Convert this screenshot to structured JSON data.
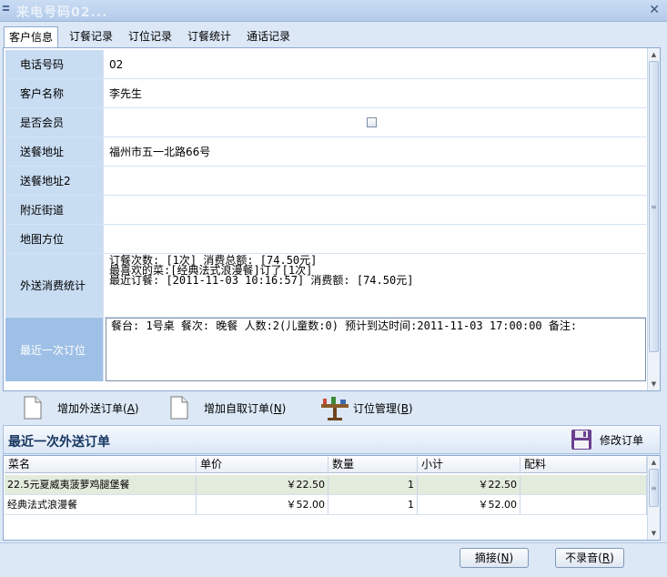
{
  "window": {
    "title": "来电号码02..."
  },
  "tabs": [
    {
      "label": "客户信息"
    },
    {
      "label": "订餐记录"
    },
    {
      "label": "订位记录"
    },
    {
      "label": "订餐统计"
    },
    {
      "label": "通话记录"
    }
  ],
  "customer": {
    "rows": [
      {
        "label": "电话号码",
        "value": "02"
      },
      {
        "label": "客户名称",
        "value": "李先生"
      },
      {
        "label": "是否会员",
        "value": "",
        "checked": false
      },
      {
        "label": "送餐地址",
        "value": "福州市五一北路66号"
      },
      {
        "label": "送餐地址2",
        "value": ""
      },
      {
        "label": "附近街道",
        "value": ""
      },
      {
        "label": "地图方位",
        "value": ""
      },
      {
        "label": "外送消费统计",
        "lines": [
          "订餐次数: [1次]  消费总额: [74.50元]",
          "最喜欢的菜:[经典法式浪漫餐]订了[1次]",
          "最近订餐: [2011-11-03 10:16:57] 消费额: [74.50元]"
        ]
      },
      {
        "label": "最近一次订位",
        "value": "餐台: 1号桌  餐次: 晚餐 人数:2(儿童数:0) 预计到达时间:2011-11-03 17:00:00 备注:"
      }
    ]
  },
  "actions": {
    "add_delivery": "增加外送订单(",
    "add_delivery_key": "A",
    "add_pickup": "增加自取订单(",
    "add_pickup_key": "N",
    "reservation": "订位管理(",
    "reservation_key": "B",
    "close_paren": ")"
  },
  "recent_order": {
    "title": "最近一次外送订单",
    "edit_label": "修改订单",
    "columns": [
      "菜名",
      "单价",
      "数量",
      "小计",
      "配料"
    ],
    "rows": [
      {
        "name": "22.5元夏威夷菠萝鸡腿堡餐",
        "price": "￥22.50",
        "qty": "1",
        "subtotal": "￥22.50",
        "extra": ""
      },
      {
        "name": "经典法式浪漫餐",
        "price": "￥52.00",
        "qty": "1",
        "subtotal": "￥52.00",
        "extra": ""
      }
    ]
  },
  "footer": {
    "answer": "摘接(",
    "answer_key": "N",
    "norecord": "不录音(",
    "norecord_key": "R",
    "close_paren": ")"
  },
  "colors": {
    "window_bg": "#dce8f6",
    "label_bg": "#c8dcf2",
    "selected_row": "#e3ebdc"
  }
}
